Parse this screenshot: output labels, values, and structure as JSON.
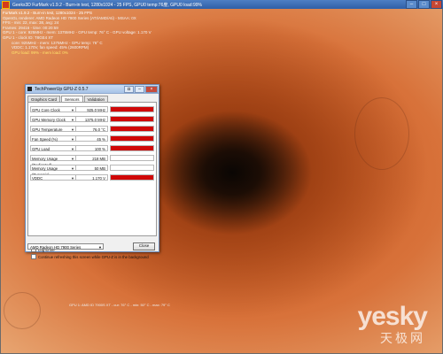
{
  "game_window": {
    "title": "Geeks3D FurMark v1.9.2 - Burn-in test, 1280x1024 - 25 FPS, GPU0 temp:76度, GPU0 load:99%",
    "controls": [
      "–",
      "□",
      "×"
    ]
  },
  "hud": {
    "lines": [
      "FurMark v1.9.2 - Burn-in test, 1280x1024 - 25 FPS",
      "OpenGL renderer: AMD Radeon HD 7900 Series (ATI/AMD/Ati) - MSAA: 0X",
      "FPS - min: 22, max: 38, avg: 24",
      "Frames: 29416 - time: 00:20:59",
      "GPU 1 - core: 925MHz - mem: 1375MHz - GPU temp: 76° C - GPU voltage: 1.170 V",
      "GPU 1 - clock ID: T8GE4 XT",
      "core: 925MHz - mem: 1375MHz - GPU temp: 76° C",
      "VDDC: 1.170V, fan speed: 45% (2600RPM)",
      "GPU load: 99% - mem load: 0%"
    ]
  },
  "bottom_status": "GPU 1: AMD ID 7900S XT - cur: 76° C - min: 50° C - max: 79° C",
  "watermark": {
    "logo": "yesky",
    "subtitle": "天极网"
  },
  "gpuz": {
    "title": "TechPowerUp GPU-Z 0.5.7",
    "tabs": [
      "Graphics Card",
      "Sensors",
      "Validation"
    ],
    "active_tab": "Sensors",
    "sensors": [
      {
        "name": "GPU Core Clock",
        "value": "925.0 MHz",
        "level": 1.0
      },
      {
        "name": "GPU Memory Clock",
        "value": "1375.0 MHz",
        "level": 1.0
      },
      {
        "name": "GPU Temperature",
        "value": "76.0 °C",
        "level": 1.0
      },
      {
        "name": "Fan Speed (%)",
        "value": "45 %",
        "level": 1.0
      },
      {
        "name": "GPU Load",
        "value": "100 %",
        "level": 1.0
      },
      {
        "name": "Memory Usage (Dedicated)",
        "value": "218 MB",
        "level": 0.0
      },
      {
        "name": "Memory Usage (Dynamic)",
        "value": "50 MB",
        "level": 0.0
      },
      {
        "name": "VDDC",
        "value": "1.170 V",
        "level": 1.0
      }
    ],
    "log_to_file_label": "Log to file",
    "refresh_bg_label": "Continue refreshing this screen while GPU-Z is in the background",
    "gpu_select": "AMD Radeon HD 7900 Series",
    "close_label": "Close",
    "bar_color": "#d00808"
  }
}
